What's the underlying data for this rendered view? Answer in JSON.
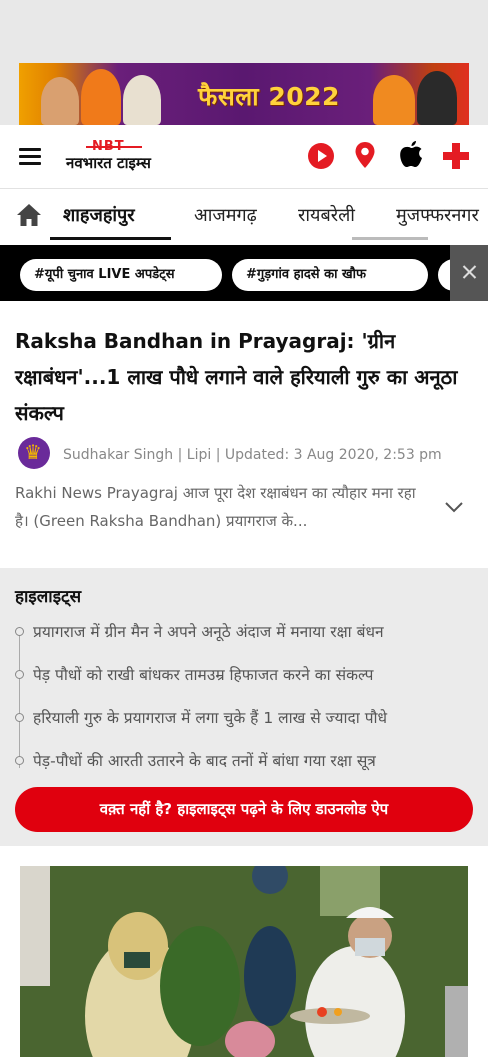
{
  "ad": {
    "text": "फैसला 2022"
  },
  "header": {
    "logo_badge": "NBT",
    "logo_name": "नवभारत टाइम्स",
    "icons": [
      "menu-icon",
      "play-icon",
      "location-icon",
      "apple-icon",
      "plus-icon"
    ]
  },
  "nav": {
    "items": [
      {
        "label": "शाहजहांपुर",
        "active": true
      },
      {
        "label": "आजमगढ़"
      },
      {
        "label": "रायबरेली"
      },
      {
        "label": "मुजफ्फरनगर"
      }
    ]
  },
  "trending": {
    "tags": [
      "#यूपी चुनाव LIVE अपडेट्स",
      "#गुड़गांव हादसे का खौफ"
    ]
  },
  "article": {
    "headline": "Raksha Bandhan in Prayagraj: 'ग्रीन रक्षाबंधन'...1 लाख पौधे लगाने वाले हरियाली गुरु का अनूठा संकल्प",
    "byline": "Sudhakar Singh | Lipi | Updated: 3 Aug 2020, 2:53 pm",
    "summary": "Rakhi News Prayagraj आज पूरा देश रक्षाबंधन का त्यौहार मना रहा है। (Green Raksha Bandhan) प्रयागराज के..."
  },
  "highlights": {
    "title": "हाइलाइट्स",
    "items": [
      "प्रयागराज में ग्रीन मैन ने अपने अनूठे अंदाज में मनाया रक्षा बंधन",
      "पेड़ पौधों को राखी बांधकर तामउम्र हिफाजत करने का संकल्प",
      "हरियाली गुरु के प्रयागराज में लगा चुके हैं 1 लाख से ज्यादा पौधे",
      "पेड़-पौधों की आरती उतारने के बाद तनों में बांधा गया रक्षा सूत्र"
    ],
    "cta": "वक़्त नहीं है? हाइलाइट्स पढ़ने के लिए डाउनलोड ऐप"
  },
  "colors": {
    "brand_red": "#e41b23",
    "cta_red": "#e0000e",
    "trending_bg": "#000000"
  }
}
